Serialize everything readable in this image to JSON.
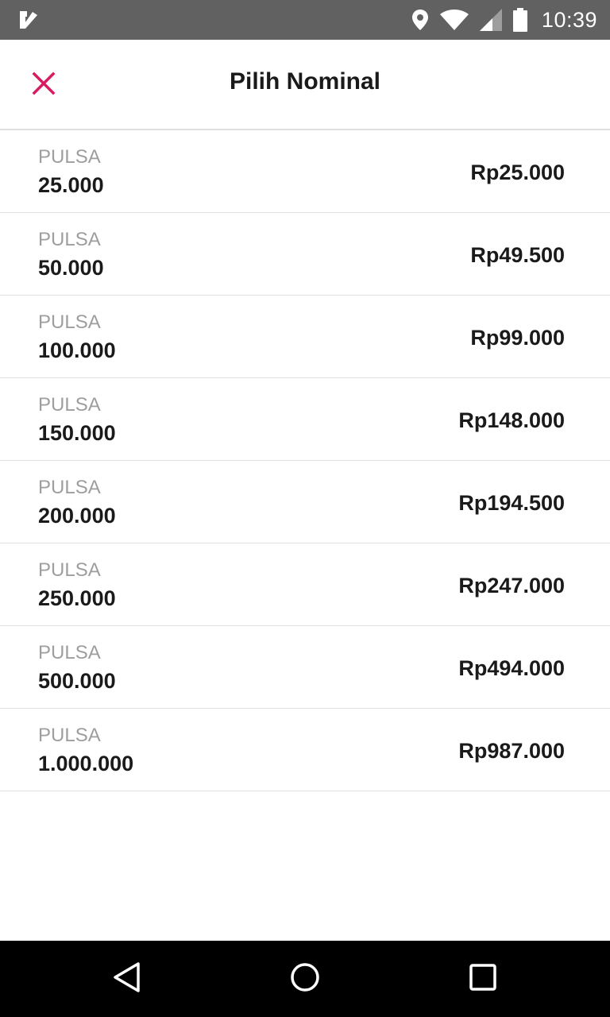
{
  "status_bar": {
    "time": "10:39",
    "icons": [
      "app-notification-icon",
      "location-icon",
      "wifi-icon",
      "signal-icon",
      "battery-icon"
    ]
  },
  "header": {
    "title": "Pilih Nominal",
    "close_icon": "close-icon",
    "accent_color": "#d81b60"
  },
  "nominals": [
    {
      "label": "PULSA",
      "amount": "25.000",
      "price": "Rp25.000"
    },
    {
      "label": "PULSA",
      "amount": "50.000",
      "price": "Rp49.500"
    },
    {
      "label": "PULSA",
      "amount": "100.000",
      "price": "Rp99.000"
    },
    {
      "label": "PULSA",
      "amount": "150.000",
      "price": "Rp148.000"
    },
    {
      "label": "PULSA",
      "amount": "200.000",
      "price": "Rp194.500"
    },
    {
      "label": "PULSA",
      "amount": "250.000",
      "price": "Rp247.000"
    },
    {
      "label": "PULSA",
      "amount": "500.000",
      "price": "Rp494.000"
    },
    {
      "label": "PULSA",
      "amount": "1.000.000",
      "price": "Rp987.000"
    }
  ],
  "nav_bar": {
    "icons": [
      "back-icon",
      "home-icon",
      "recents-icon"
    ]
  }
}
